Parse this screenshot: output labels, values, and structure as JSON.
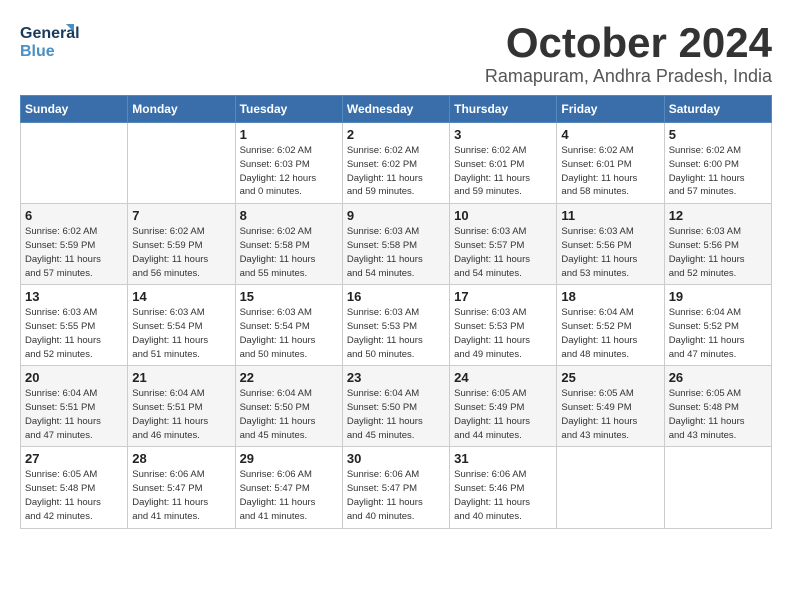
{
  "logo": {
    "line1": "General",
    "line2": "Blue"
  },
  "title": {
    "month": "October 2024",
    "location": "Ramapuram, Andhra Pradesh, India"
  },
  "headers": [
    "Sunday",
    "Monday",
    "Tuesday",
    "Wednesday",
    "Thursday",
    "Friday",
    "Saturday"
  ],
  "weeks": [
    [
      {
        "day": "",
        "info": ""
      },
      {
        "day": "",
        "info": ""
      },
      {
        "day": "1",
        "info": "Sunrise: 6:02 AM\nSunset: 6:03 PM\nDaylight: 12 hours\nand 0 minutes."
      },
      {
        "day": "2",
        "info": "Sunrise: 6:02 AM\nSunset: 6:02 PM\nDaylight: 11 hours\nand 59 minutes."
      },
      {
        "day": "3",
        "info": "Sunrise: 6:02 AM\nSunset: 6:01 PM\nDaylight: 11 hours\nand 59 minutes."
      },
      {
        "day": "4",
        "info": "Sunrise: 6:02 AM\nSunset: 6:01 PM\nDaylight: 11 hours\nand 58 minutes."
      },
      {
        "day": "5",
        "info": "Sunrise: 6:02 AM\nSunset: 6:00 PM\nDaylight: 11 hours\nand 57 minutes."
      }
    ],
    [
      {
        "day": "6",
        "info": "Sunrise: 6:02 AM\nSunset: 5:59 PM\nDaylight: 11 hours\nand 57 minutes."
      },
      {
        "day": "7",
        "info": "Sunrise: 6:02 AM\nSunset: 5:59 PM\nDaylight: 11 hours\nand 56 minutes."
      },
      {
        "day": "8",
        "info": "Sunrise: 6:02 AM\nSunset: 5:58 PM\nDaylight: 11 hours\nand 55 minutes."
      },
      {
        "day": "9",
        "info": "Sunrise: 6:03 AM\nSunset: 5:58 PM\nDaylight: 11 hours\nand 54 minutes."
      },
      {
        "day": "10",
        "info": "Sunrise: 6:03 AM\nSunset: 5:57 PM\nDaylight: 11 hours\nand 54 minutes."
      },
      {
        "day": "11",
        "info": "Sunrise: 6:03 AM\nSunset: 5:56 PM\nDaylight: 11 hours\nand 53 minutes."
      },
      {
        "day": "12",
        "info": "Sunrise: 6:03 AM\nSunset: 5:56 PM\nDaylight: 11 hours\nand 52 minutes."
      }
    ],
    [
      {
        "day": "13",
        "info": "Sunrise: 6:03 AM\nSunset: 5:55 PM\nDaylight: 11 hours\nand 52 minutes."
      },
      {
        "day": "14",
        "info": "Sunrise: 6:03 AM\nSunset: 5:54 PM\nDaylight: 11 hours\nand 51 minutes."
      },
      {
        "day": "15",
        "info": "Sunrise: 6:03 AM\nSunset: 5:54 PM\nDaylight: 11 hours\nand 50 minutes."
      },
      {
        "day": "16",
        "info": "Sunrise: 6:03 AM\nSunset: 5:53 PM\nDaylight: 11 hours\nand 50 minutes."
      },
      {
        "day": "17",
        "info": "Sunrise: 6:03 AM\nSunset: 5:53 PM\nDaylight: 11 hours\nand 49 minutes."
      },
      {
        "day": "18",
        "info": "Sunrise: 6:04 AM\nSunset: 5:52 PM\nDaylight: 11 hours\nand 48 minutes."
      },
      {
        "day": "19",
        "info": "Sunrise: 6:04 AM\nSunset: 5:52 PM\nDaylight: 11 hours\nand 47 minutes."
      }
    ],
    [
      {
        "day": "20",
        "info": "Sunrise: 6:04 AM\nSunset: 5:51 PM\nDaylight: 11 hours\nand 47 minutes."
      },
      {
        "day": "21",
        "info": "Sunrise: 6:04 AM\nSunset: 5:51 PM\nDaylight: 11 hours\nand 46 minutes."
      },
      {
        "day": "22",
        "info": "Sunrise: 6:04 AM\nSunset: 5:50 PM\nDaylight: 11 hours\nand 45 minutes."
      },
      {
        "day": "23",
        "info": "Sunrise: 6:04 AM\nSunset: 5:50 PM\nDaylight: 11 hours\nand 45 minutes."
      },
      {
        "day": "24",
        "info": "Sunrise: 6:05 AM\nSunset: 5:49 PM\nDaylight: 11 hours\nand 44 minutes."
      },
      {
        "day": "25",
        "info": "Sunrise: 6:05 AM\nSunset: 5:49 PM\nDaylight: 11 hours\nand 43 minutes."
      },
      {
        "day": "26",
        "info": "Sunrise: 6:05 AM\nSunset: 5:48 PM\nDaylight: 11 hours\nand 43 minutes."
      }
    ],
    [
      {
        "day": "27",
        "info": "Sunrise: 6:05 AM\nSunset: 5:48 PM\nDaylight: 11 hours\nand 42 minutes."
      },
      {
        "day": "28",
        "info": "Sunrise: 6:06 AM\nSunset: 5:47 PM\nDaylight: 11 hours\nand 41 minutes."
      },
      {
        "day": "29",
        "info": "Sunrise: 6:06 AM\nSunset: 5:47 PM\nDaylight: 11 hours\nand 41 minutes."
      },
      {
        "day": "30",
        "info": "Sunrise: 6:06 AM\nSunset: 5:47 PM\nDaylight: 11 hours\nand 40 minutes."
      },
      {
        "day": "31",
        "info": "Sunrise: 6:06 AM\nSunset: 5:46 PM\nDaylight: 11 hours\nand 40 minutes."
      },
      {
        "day": "",
        "info": ""
      },
      {
        "day": "",
        "info": ""
      }
    ]
  ]
}
